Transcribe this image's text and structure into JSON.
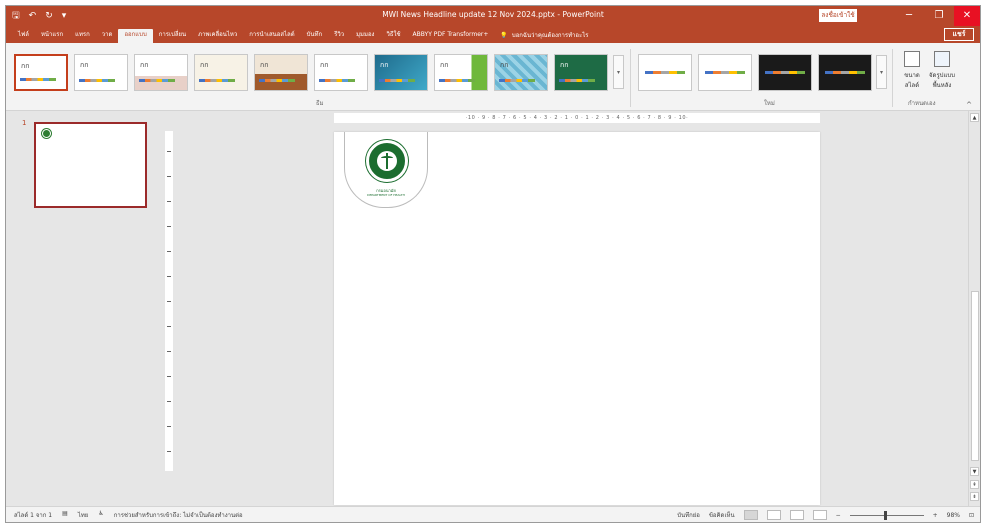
{
  "window": {
    "title": "MWI News Headline update 12 Nov 2024.pptx - PowerPoint",
    "signin": "ลงชื่อเข้าใช้",
    "minimize": "─",
    "restore": "❐",
    "close": "✕"
  },
  "qat": {
    "save": "🖫",
    "undo": "↶",
    "redo": "↻",
    "customize": "▾"
  },
  "tabs": [
    {
      "label": "ไฟล์"
    },
    {
      "label": "หน้าแรก"
    },
    {
      "label": "แทรก"
    },
    {
      "label": "วาด"
    },
    {
      "label": "ออกแบบ"
    },
    {
      "label": "การเปลี่ยน"
    },
    {
      "label": "ภาพเคลื่อนไหว"
    },
    {
      "label": "การนำเสนอสไลด์"
    },
    {
      "label": "บันทึก"
    },
    {
      "label": "รีวิว"
    },
    {
      "label": "มุมมอง"
    },
    {
      "label": "วิธีใช้"
    },
    {
      "label": "ABBYY PDF Transformer+"
    }
  ],
  "active_tab": "ออกแบบ",
  "tell_me": "บอกฉันว่าคุณต้องการทำอะไร",
  "share": "แชร์",
  "ribbon": {
    "themes_label": "ธีม",
    "variants_label": "ใหม่",
    "customize_label": "กำหนดเอง",
    "theme_text": "กก",
    "slide_size": "ขนาด สไลด์",
    "format_bg": "จัดรูปแบบ พื้นหลัง"
  },
  "ruler": "·10 · 9 · 8 · 7 · 6 · 5 · 4 · 3 · 2 · 1 · 0 · 1 · 2 · 3 · 4 · 5 · 6 · 7 · 8 · 9 · 10·",
  "thumbnails": [
    {
      "number": "1"
    }
  ],
  "slide": {
    "logo_caption": "กรมอนามัย",
    "logo_subcaption": "DEPARTMENT OF HEALTH"
  },
  "status": {
    "slide_count": "สไลด์ 1 จาก 1",
    "language": "ไทย",
    "accessibility": "การช่วยสำหรับการเข้าถึง: ไม่จำเป็นต้องทำงานต่อ",
    "notes": "บันทึกย่อ",
    "comments": "ข้อคิดเห็น",
    "zoom": "98%"
  },
  "colors": {
    "accent": "#b7472a",
    "close": "#e81123",
    "logo_green": "#1b6d2f"
  }
}
